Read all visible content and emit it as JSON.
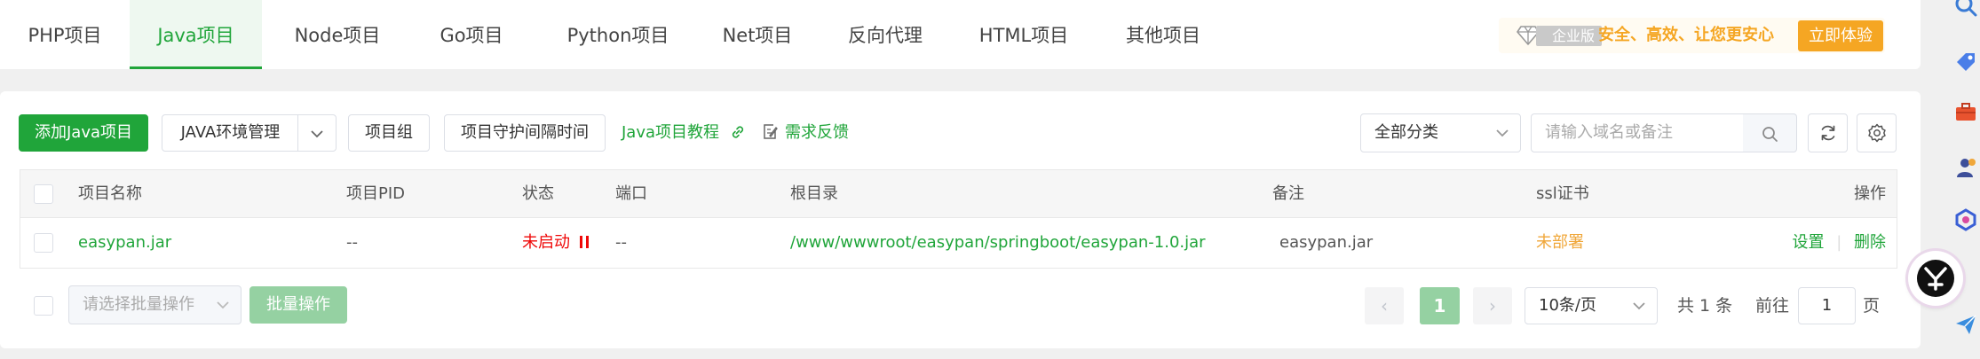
{
  "tabs": [
    {
      "label": "PHP项目"
    },
    {
      "label": "Java项目"
    },
    {
      "label": "Node项目"
    },
    {
      "label": "Go项目"
    },
    {
      "label": "Python项目"
    },
    {
      "label": "Net项目"
    },
    {
      "label": "反向代理"
    },
    {
      "label": "HTML项目"
    },
    {
      "label": "其他项目"
    }
  ],
  "active_tab": "Java项目",
  "promo": {
    "edition": "企业版",
    "text": "安全、高效、让您更安心",
    "button": "立即体验"
  },
  "toolbar": {
    "add_button": "添加Java项目",
    "env_button": "JAVA环境管理",
    "group_button": "项目组",
    "interval_button": "项目守护间隔时间",
    "tutorial_link": "Java项目教程",
    "feedback_link": "需求反馈",
    "category_select": "全部分类",
    "search_placeholder": "请输入域名或备注"
  },
  "table": {
    "headers": [
      "项目名称",
      "项目PID",
      "状态",
      "端口",
      "根目录",
      "备注",
      "ssl证书",
      "操作"
    ],
    "rows": [
      {
        "name": "easypan.jar",
        "pid": "--",
        "status": "未启动",
        "port": "--",
        "root": "/www/wwwroot/easypan/springboot/easypan-1.0.jar",
        "remark": "easypan.jar",
        "ssl": "未部署",
        "action_settings": "设置",
        "action_separator": "|",
        "action_delete": "删除"
      }
    ]
  },
  "footer": {
    "batch_placeholder": "请选择批量操作",
    "batch_button": "批量操作",
    "prev": "‹",
    "page": "1",
    "next": "›",
    "page_size": "10条/页",
    "total": "共 1 条",
    "goto_prefix": "前往",
    "goto_value": "1",
    "goto_suffix": "页"
  },
  "colors": {
    "accent": "#20a53a",
    "danger": "#ef0808",
    "warning": "#f0a73a",
    "promo": "#f5a623"
  },
  "side_icons": [
    "search-icon",
    "tag-icon",
    "toolbox-icon",
    "user-icon",
    "plugin-icon",
    "send-icon"
  ]
}
